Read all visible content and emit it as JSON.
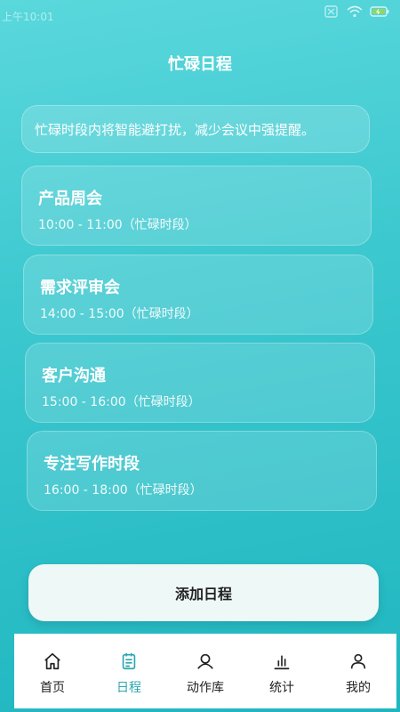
{
  "status_bar": {
    "time": "上午10:01"
  },
  "page": {
    "title": "忙碌日程"
  },
  "notice": {
    "text": "忙碌时段内将智能避打扰，减少会议中强提醒。"
  },
  "schedule": [
    {
      "title": "产品周会",
      "time": "10:00 - 11:00（忙碌时段）"
    },
    {
      "title": "需求评审会",
      "time": "14:00 - 15:00（忙碌时段）"
    },
    {
      "title": "客户沟通",
      "time": "15:00 - 16:00（忙碌时段）"
    },
    {
      "title": "专注写作时段",
      "time": "16:00 - 18:00（忙碌时段）"
    }
  ],
  "add_button": {
    "label": "添加日程"
  },
  "tabs": [
    {
      "label": "首页",
      "icon": "home-icon"
    },
    {
      "label": "日程",
      "icon": "calendar-icon",
      "active": true
    },
    {
      "label": "动作库",
      "icon": "person-arc-icon"
    },
    {
      "label": "统计",
      "icon": "bar-chart-icon"
    },
    {
      "label": "我的",
      "icon": "profile-icon"
    }
  ],
  "colors": {
    "accent": "#2aa7b2",
    "gradient_top": "#5ad8dc",
    "gradient_bottom": "#1fb6c0"
  }
}
